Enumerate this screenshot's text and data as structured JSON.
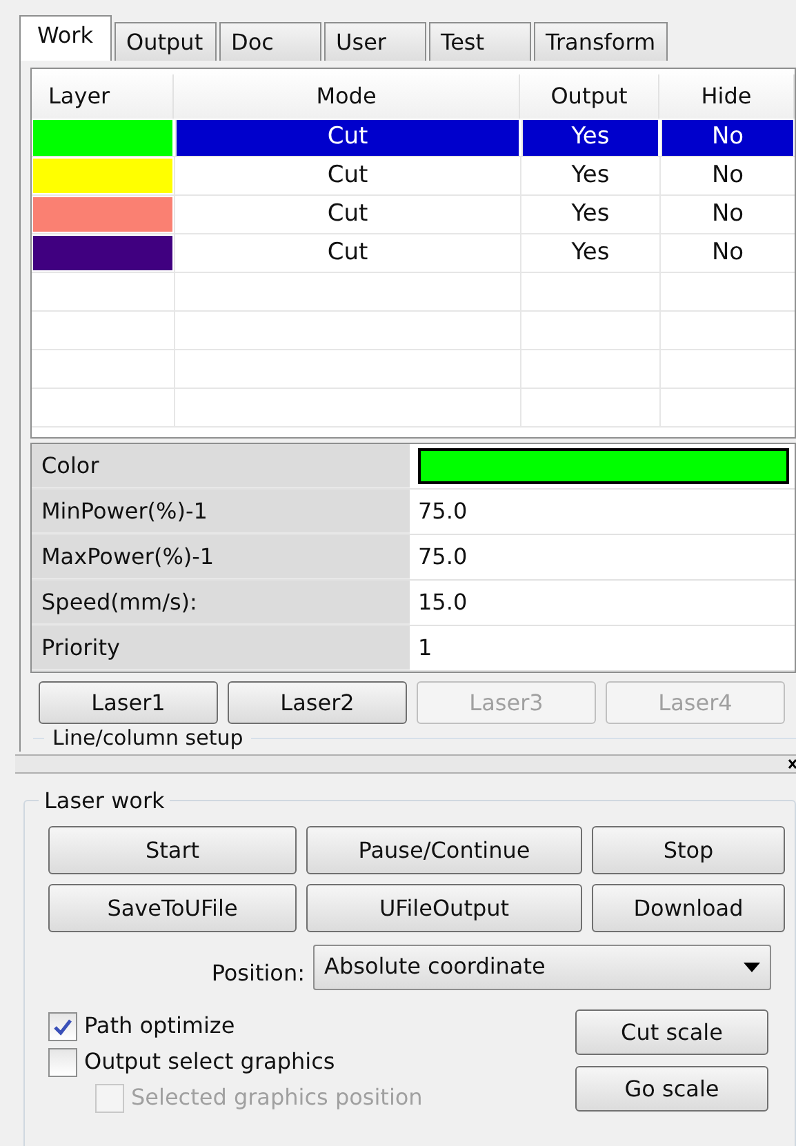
{
  "tabs": [
    {
      "label": "Work",
      "selected": true
    },
    {
      "label": "Output",
      "selected": false
    },
    {
      "label": "Doc",
      "selected": false
    },
    {
      "label": "User",
      "selected": false
    },
    {
      "label": "Test",
      "selected": false
    },
    {
      "label": "Transform",
      "selected": false
    }
  ],
  "layer_table": {
    "columns": [
      "Layer",
      "Mode",
      "Output",
      "Hide"
    ],
    "rows": [
      {
        "color": "#00ff00",
        "mode": "Cut",
        "output": "Yes",
        "hide": "No",
        "selected": true
      },
      {
        "color": "#ffff00",
        "mode": "Cut",
        "output": "Yes",
        "hide": "No",
        "selected": false
      },
      {
        "color": "#fa8072",
        "mode": "Cut",
        "output": "Yes",
        "hide": "No",
        "selected": false
      },
      {
        "color": "#400080",
        "mode": "Cut",
        "output": "Yes",
        "hide": "No",
        "selected": false
      }
    ]
  },
  "properties": [
    {
      "kind": "color",
      "label": "Color",
      "color": "#00ff00"
    },
    {
      "kind": "text",
      "label": "MinPower(%)-1",
      "value": "75.0"
    },
    {
      "kind": "text",
      "label": "MaxPower(%)-1",
      "value": "75.0"
    },
    {
      "kind": "text",
      "label": "Speed(mm/s):",
      "value": "15.0"
    },
    {
      "kind": "text",
      "label": "Priority",
      "value": "1"
    }
  ],
  "laser_buttons": [
    {
      "label": "Laser1",
      "disabled": false
    },
    {
      "label": "Laser2",
      "disabled": false
    },
    {
      "label": "Laser3",
      "disabled": true
    },
    {
      "label": "Laser4",
      "disabled": true
    }
  ],
  "line_column_setup": {
    "title": "Line/column setup"
  },
  "laser_work": {
    "title": "Laser work",
    "buttons": [
      "Start",
      "Pause/Continue",
      "Stop",
      "SaveToUFile",
      "UFileOutput",
      "Download"
    ],
    "position": {
      "label": "Position:",
      "value": "Absolute coordinate"
    },
    "checkboxes": [
      {
        "label": "Path optimize",
        "checked": true,
        "disabled": false,
        "indented": false
      },
      {
        "label": "Output select graphics",
        "checked": false,
        "disabled": false,
        "indented": false
      },
      {
        "label": "Selected graphics position",
        "checked": false,
        "disabled": true,
        "indented": true
      }
    ],
    "scale_buttons": [
      "Cut scale",
      "Go scale"
    ]
  }
}
